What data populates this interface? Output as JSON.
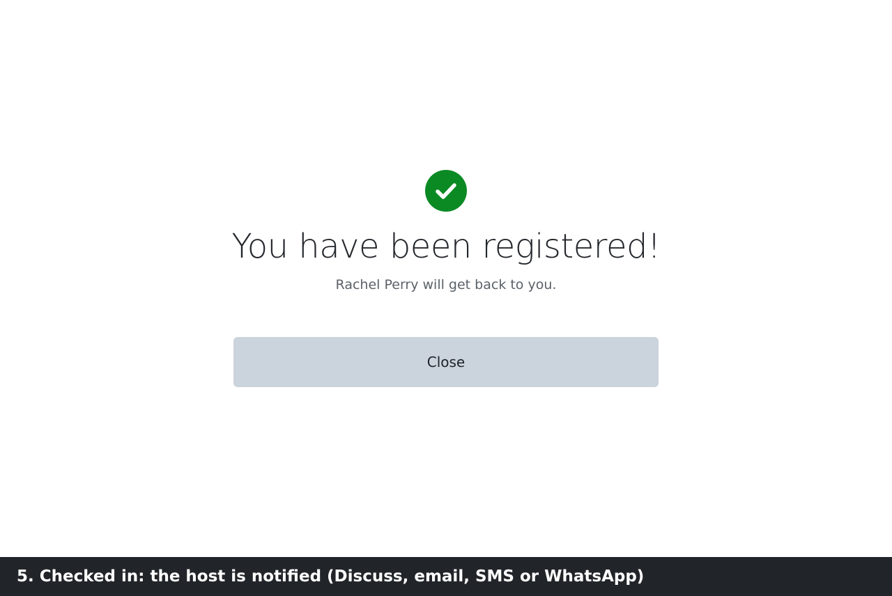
{
  "confirmation": {
    "icon": "check-circle-icon",
    "icon_color": "#0b8a24",
    "title": "You have been registered!",
    "message": "Rachel Perry will get back to you.",
    "close_label": "Close"
  },
  "caption": {
    "text": "5. Checked in: the host is notified (Discuss, email, SMS or WhatsApp)"
  }
}
